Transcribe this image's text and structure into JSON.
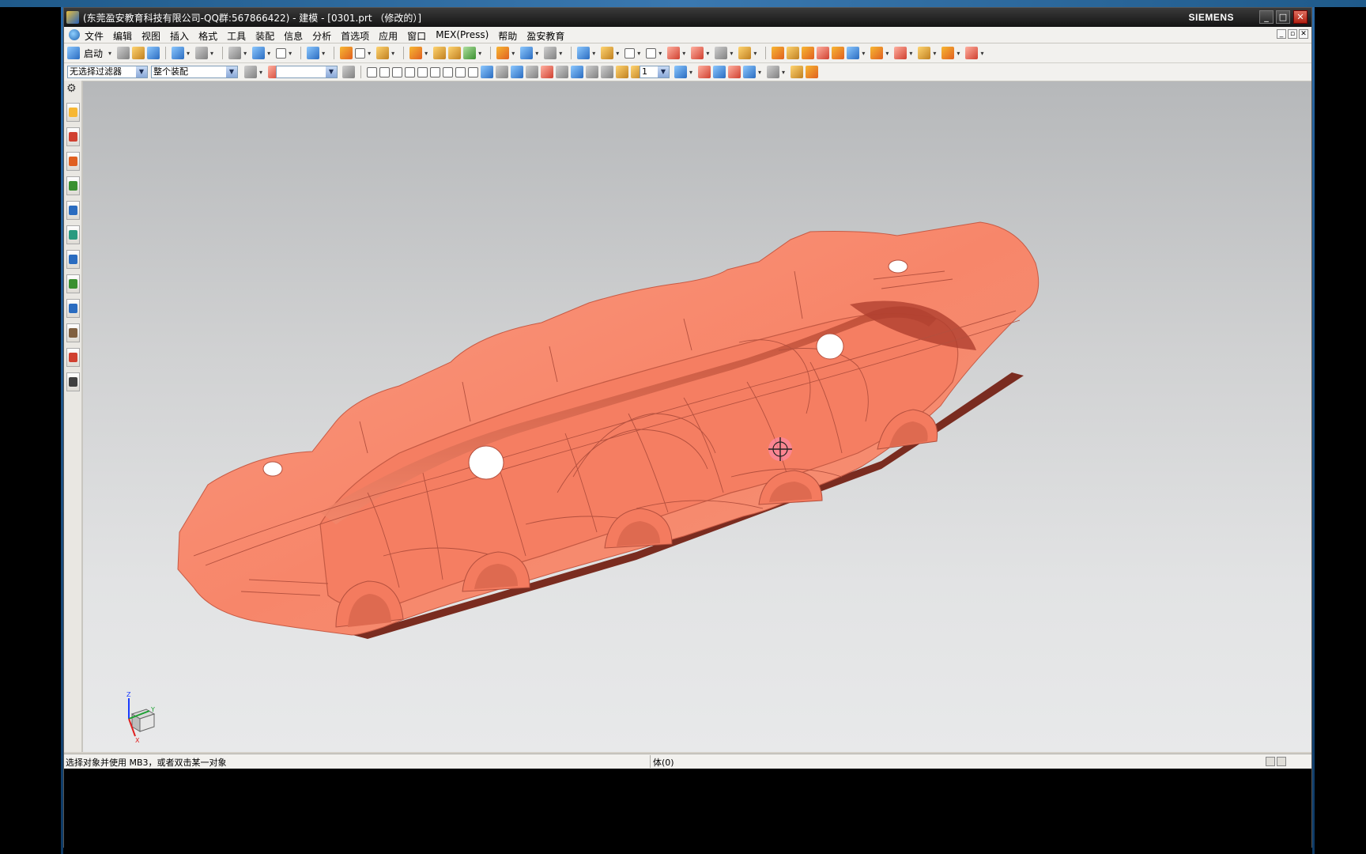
{
  "window": {
    "title": "(东莞盈安教育科技有限公司-QQ群:567866422) - 建模 - [0301.prt （修改的）]",
    "brand": "SIEMENS",
    "controls": {
      "minimize": "_",
      "maximize": "□",
      "close": "✕"
    }
  },
  "menubar": {
    "items": [
      "文件",
      "编辑",
      "视图",
      "插入",
      "格式",
      "工具",
      "装配",
      "信息",
      "分析",
      "首选项",
      "应用",
      "窗口",
      "MEX(Press)",
      "帮助",
      "盈安教育"
    ],
    "mdi_controls": [
      "_",
      "▫",
      "✕"
    ]
  },
  "toolbar": {
    "start_label": "启动",
    "selection_filter": "无选择过滤器",
    "assembly_scope": "整个装配",
    "layer_value": "",
    "snap_value": "1"
  },
  "resource_bar": {
    "icons": [
      "assembly-navigator-icon",
      "constraint-navigator-icon",
      "part-navigator-icon",
      "reuse-library-icon",
      "web-browser-icon",
      "history-icon",
      "system-materials-icon",
      "process-studio-icon",
      "manufacturing-wizard-icon",
      "roles-icon",
      "system-scenes-icon",
      "palette-icon"
    ]
  },
  "viewport": {
    "model_color": "#f88a70",
    "model_name": "sheet-metal-part",
    "cursor": "crosshair-cursor",
    "triad_axes": [
      "Z",
      "Y",
      "X"
    ]
  },
  "statusbar": {
    "prompt": "选择对象并使用 MB3，或者双击某一对象",
    "status": "体(0)"
  }
}
